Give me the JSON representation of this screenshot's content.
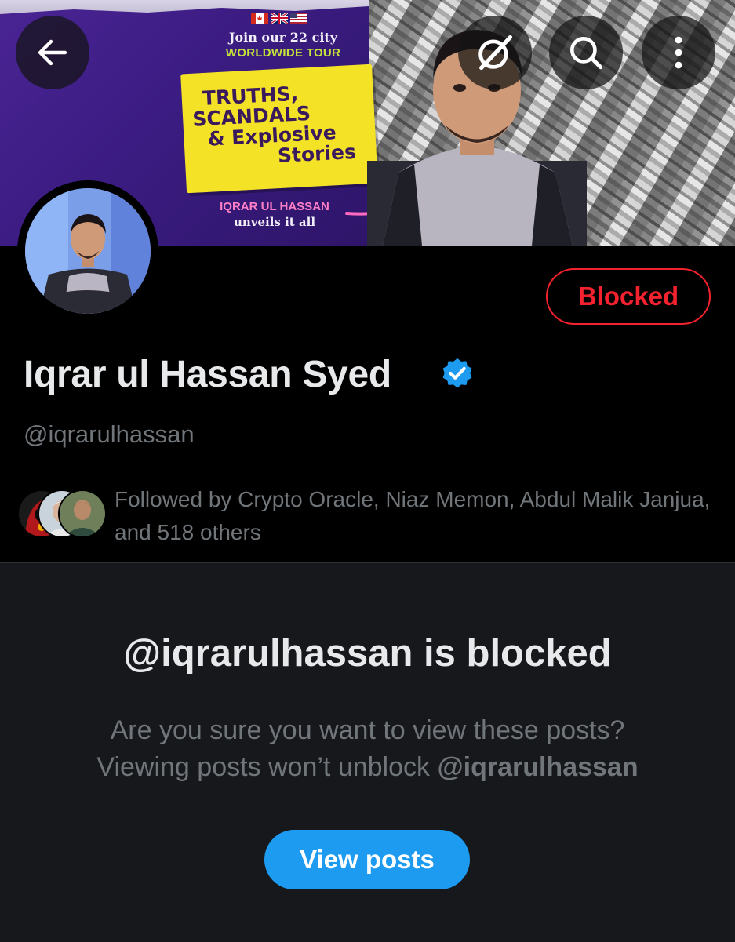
{
  "banner": {
    "tour_line1": "Join our 22 city",
    "tour_line2": "WORLDWIDE TOUR",
    "headline": [
      "TRUTHS,",
      "SCANDALS",
      "& Explosive",
      "Stories"
    ],
    "promo_name": "IQRAR UL HASSAN",
    "promo_sub": "unveils it all"
  },
  "top_bar": {
    "back_icon": "arrow-left-icon",
    "grok_icon": "grok-icon",
    "search_icon": "search-icon",
    "more_icon": "more-vertical-icon"
  },
  "profile": {
    "display_name": "Iqrar ul Hassan Syed",
    "handle": "@iqrarulhassan",
    "verified": true,
    "blocked_label": "Blocked",
    "followed_by": "Followed by Crypto Oracle, Niaz Memon, Abdul Malik Janjua, and 518 others"
  },
  "blocked_panel": {
    "title": "@iqrarulhassan is blocked",
    "line1": "Are you sure you want to view these posts?",
    "line2_prefix": "Viewing posts won’t unblock ",
    "line2_handle": "@iqrarulhassan",
    "view_button": "View posts"
  },
  "colors": {
    "accent_blue": "#1d9bf0",
    "blocked_red": "#f4212e",
    "muted_text": "#71767b",
    "panel_bg": "#16181c"
  }
}
